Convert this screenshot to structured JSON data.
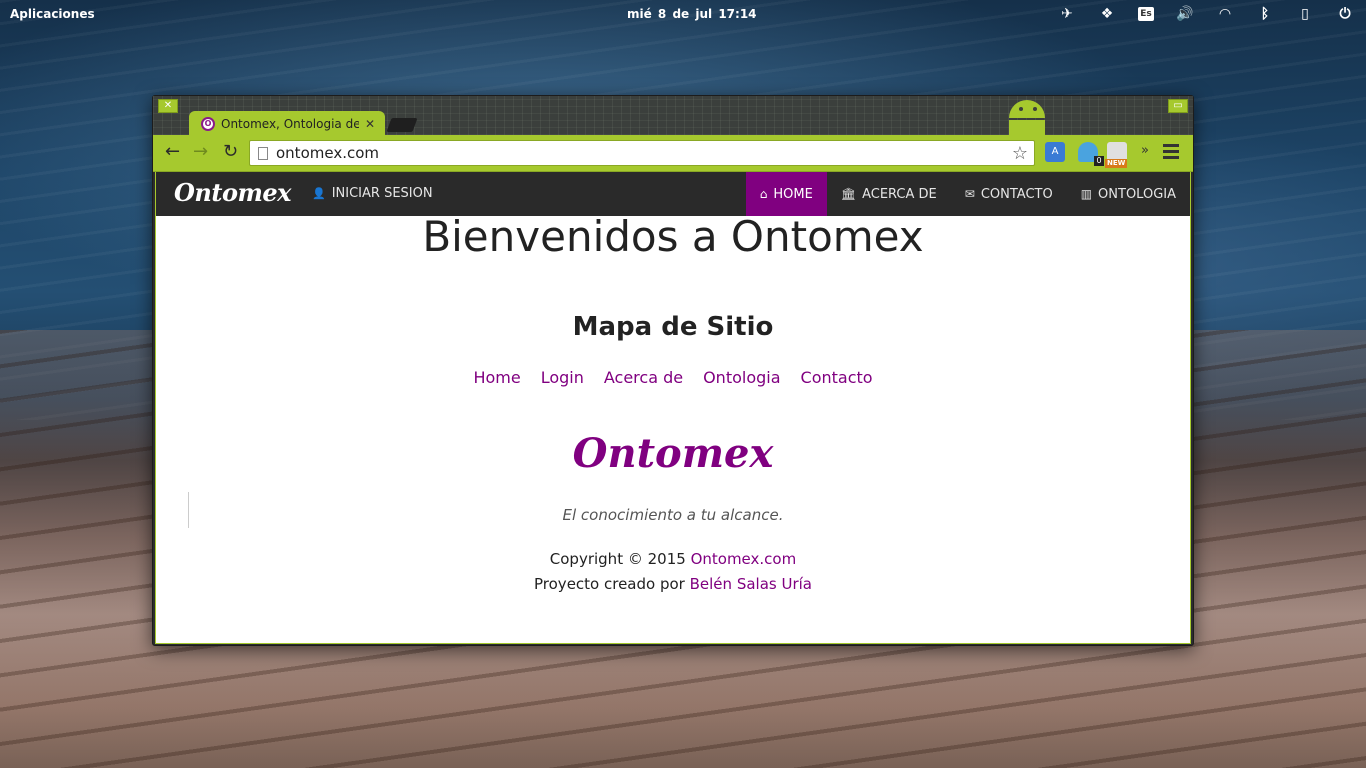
{
  "desktop": {
    "apps_label": "Aplicaciones",
    "clock": "mié  8 de jul    17:14",
    "tray": {
      "lang": "Es"
    }
  },
  "browser": {
    "tab_title": "Ontomex, Ontologia de C",
    "url": "ontomex.com",
    "ext_badge_count": "0",
    "ext_new_badge": "NEW"
  },
  "site": {
    "brand": "Ontomex",
    "nav": {
      "login": "INICIAR SESION",
      "home": "HOME",
      "about": "ACERCA DE",
      "contact": "CONTACTO",
      "ontology": "ONTOLOGIA"
    },
    "welcome": "Bienvenidos a Ontomex",
    "sitemap_title": "Mapa de Sitio",
    "sitemap_links": [
      "Home",
      "Login",
      "Acerca de",
      "Ontologia",
      "Contacto"
    ],
    "footer_logo": "Ontomex",
    "tagline": "El conocimiento a tu alcance.",
    "copyright_prefix": "Copyright © 2015",
    "copyright_link": "Ontomex.com",
    "project_prefix": "Proyecto creado por",
    "project_author": "Belén Salas Uría"
  },
  "colors": {
    "accent": "#800080",
    "browser_theme": "#a6c92e",
    "navbar": "#2a2a2a"
  }
}
